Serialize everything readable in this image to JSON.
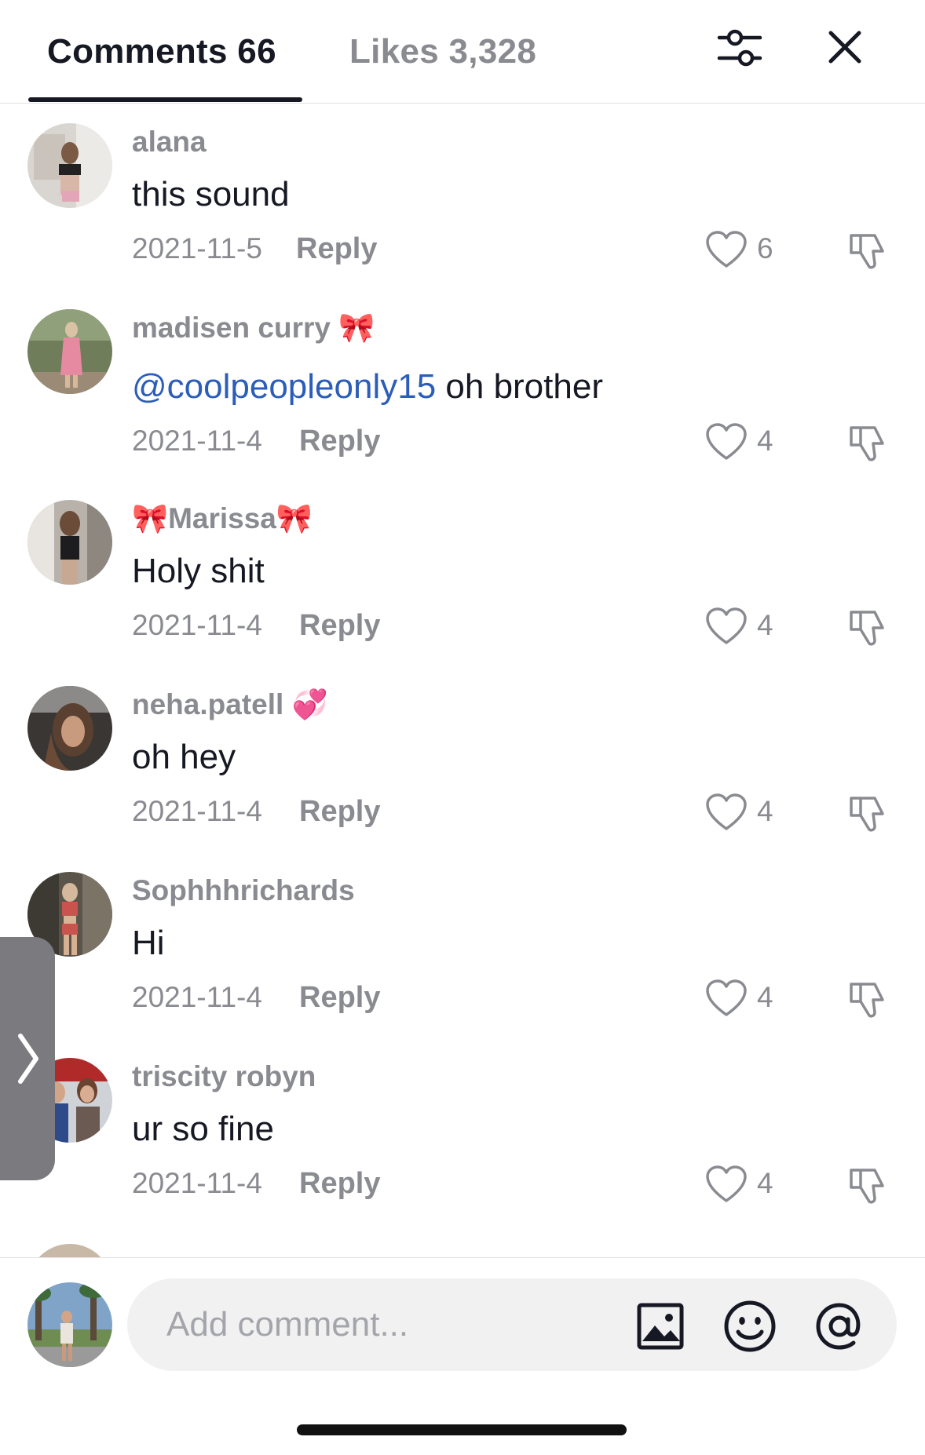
{
  "header": {
    "comments_tab": "Comments 66",
    "likes_tab": "Likes 3,328"
  },
  "comments": [
    {
      "username": "alana",
      "text": "this sound",
      "date": "2021-11-5",
      "reply": "Reply",
      "likes": "6"
    },
    {
      "username": "madisen curry 🎀",
      "mention": "@coolpeopleonly15",
      "text": " oh brother",
      "date": "2021-11-4",
      "reply": "Reply",
      "likes": "4"
    },
    {
      "username": "🎀Marissa🎀",
      "text": "Holy shit",
      "date": "2021-11-4",
      "reply": "Reply",
      "likes": "4"
    },
    {
      "username": "neha.patell 💞",
      "text": "oh hey",
      "date": "2021-11-4",
      "reply": "Reply",
      "likes": "4"
    },
    {
      "username": "Sophhhrichards",
      "text": "Hi",
      "date": "2021-11-4",
      "reply": "Reply",
      "likes": "4"
    },
    {
      "username": "triscity robyn",
      "text": "ur so fine",
      "date": "2021-11-4",
      "reply": "Reply",
      "likes": "4"
    }
  ],
  "composer": {
    "placeholder": "Add comment..."
  },
  "icons": {
    "filter": "sliders-icon",
    "close": "close-icon",
    "like": "heart-outline-icon",
    "dislike": "thumbs-down-icon",
    "image": "image-icon",
    "emoji": "smiley-icon",
    "mention": "at-sign-icon",
    "side_handle": "chevron-right-icon"
  },
  "colors": {
    "text_primary": "#161823",
    "text_secondary": "#8a8b91",
    "mention": "#2b5db9",
    "input_bg": "#f1f1f2"
  }
}
